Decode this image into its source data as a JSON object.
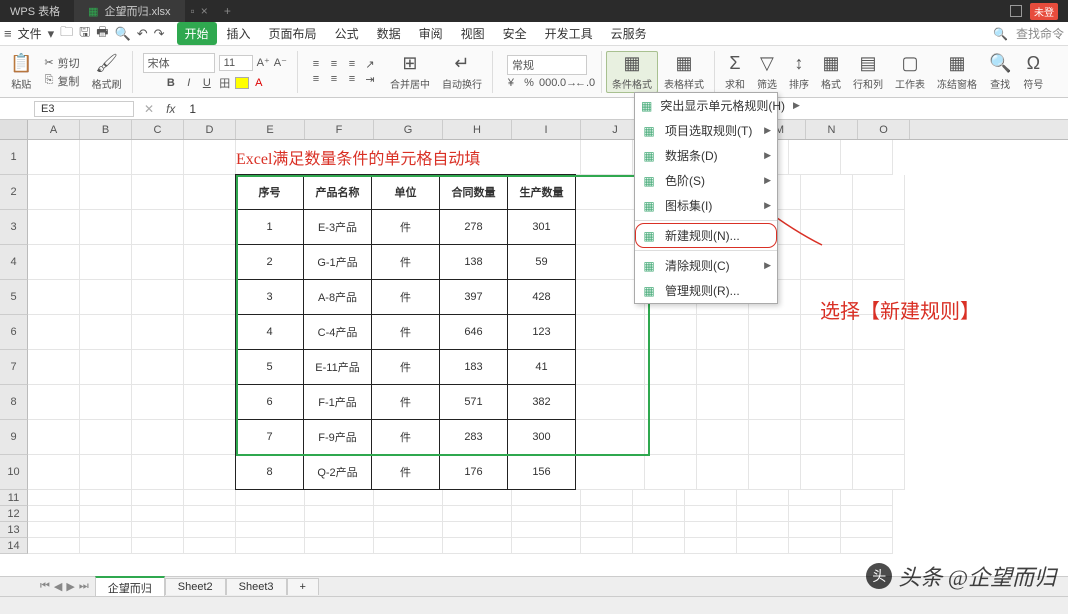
{
  "title": {
    "app": "WPS 表格",
    "file": "企望而归.xlsx",
    "login": "未登"
  },
  "menubar": {
    "file": "文件",
    "tabs": [
      "开始",
      "插入",
      "页面布局",
      "公式",
      "数据",
      "审阅",
      "视图",
      "安全",
      "开发工具",
      "云服务"
    ],
    "search": "查找命令"
  },
  "ribbon": {
    "paste": "粘贴",
    "cut": "剪切",
    "copy": "复制",
    "fmtpaint": "格式刷",
    "font": "宋体",
    "size": "11",
    "merge": "合并居中",
    "wrap": "自动换行",
    "numfmt": "常规",
    "condfmt": "条件格式",
    "tblstyle": "表格样式",
    "sum": "求和",
    "filter": "筛选",
    "sort": "排序",
    "format": "格式",
    "rowcol": "行和列",
    "sheet": "工作表",
    "freeze": "冻结窗格",
    "find": "查找",
    "symbol": "符号"
  },
  "namebox": "E3",
  "formula": "1",
  "cols": [
    "A",
    "B",
    "C",
    "D",
    "E",
    "F",
    "G",
    "H",
    "I",
    "J",
    "K",
    "L",
    "M",
    "N",
    "O"
  ],
  "titletext": "Excel满足数量条件的单元格自动填",
  "thead": [
    "序号",
    "产品名称",
    "单位",
    "合同数量",
    "生产数量"
  ],
  "rows": [
    {
      "n": "1",
      "p": "E-3产品",
      "u": "件",
      "a": "278",
      "b": "301"
    },
    {
      "n": "2",
      "p": "G-1产品",
      "u": "件",
      "a": "138",
      "b": "59"
    },
    {
      "n": "3",
      "p": "A-8产品",
      "u": "件",
      "a": "397",
      "b": "428"
    },
    {
      "n": "4",
      "p": "C-4产品",
      "u": "件",
      "a": "646",
      "b": "123"
    },
    {
      "n": "5",
      "p": "E-11产品",
      "u": "件",
      "a": "183",
      "b": "41"
    },
    {
      "n": "6",
      "p": "F-1产品",
      "u": "件",
      "a": "571",
      "b": "382"
    },
    {
      "n": "7",
      "p": "F-9产品",
      "u": "件",
      "a": "283",
      "b": "300"
    },
    {
      "n": "8",
      "p": "Q-2产品",
      "u": "件",
      "a": "176",
      "b": "156"
    }
  ],
  "dd": {
    "items": [
      {
        "t": "突出显示单元格规则(H)",
        "s": true
      },
      {
        "t": "项目选取规则(T)",
        "s": true
      },
      {
        "t": "数据条(D)",
        "s": true
      },
      {
        "t": "色阶(S)",
        "s": true
      },
      {
        "t": "图标集(I)",
        "s": true
      },
      {
        "t": "新建规则(N)...",
        "s": false,
        "hl": true
      },
      {
        "t": "清除规则(C)",
        "s": true
      },
      {
        "t": "管理规则(R)...",
        "s": false
      }
    ]
  },
  "callout": "选择【新建规则】",
  "sheets": {
    "active": "企望而归",
    "others": [
      "Sheet2",
      "Sheet3"
    ],
    "add": "+"
  },
  "watermark": "头条 @企望而归"
}
